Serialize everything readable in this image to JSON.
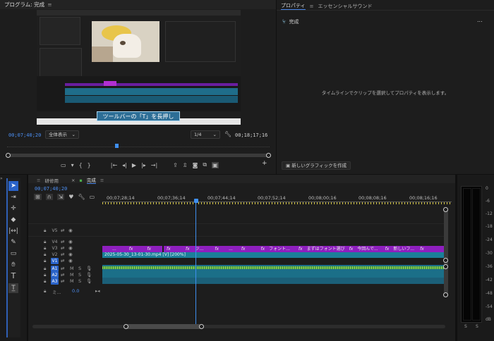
{
  "program": {
    "title": "プログラム: 完成",
    "timecode": "00;07;40;20",
    "zoom": "全体表示",
    "resolution": "1/4",
    "duration": "00;18;17;16",
    "caption": "ツールバーの「T」を長押し"
  },
  "properties": {
    "tab_properties": "プロパティ",
    "tab_essential": "エッセンシャルサウンド",
    "sequence": "完成",
    "message": "タイムラインでクリップを選択してプロパティを表示します。",
    "new_graphic": "新しいグラフィックを作成",
    "more": "..."
  },
  "timeline": {
    "tab1": "研修用",
    "tab2": "完成",
    "timecode": "00;07;40;20",
    "ruler": [
      "00;07;28;14",
      "00;07;36;14",
      "00;07;44;14",
      "00;07;52;14",
      "00;08;00;16",
      "00;08;08;16",
      "00;08;16;16"
    ],
    "tracks": [
      {
        "name": "V5",
        "active": false
      },
      {
        "name": "V4",
        "active": false
      },
      {
        "name": "V3",
        "active": false
      },
      {
        "name": "V2",
        "active": false
      },
      {
        "name": "V1",
        "active": true
      },
      {
        "name": "A1",
        "active": true
      },
      {
        "name": "A2",
        "active": true
      },
      {
        "name": "A3",
        "active": true
      }
    ],
    "mix_label": "ミ...",
    "mix_value": "0.0",
    "v1_clip": "2025-05-30_13-01-30.mp4 [V] [200%]",
    "v2_clips": [
      "...",
      "fx",
      "fx",
      "fx",
      "fx",
      "ツ...",
      "fx",
      "...",
      "fx",
      "fx",
      "フォント...",
      "fx",
      "まずはフォント選び",
      "fx",
      "今回んで...",
      "fx",
      "新しいフ...",
      "fx"
    ]
  },
  "meter": {
    "labels": [
      "0",
      "-6",
      "-12",
      "-18",
      "-24",
      "-30",
      "-36",
      "-42",
      "-48",
      "-54",
      "dB"
    ],
    "solo": [
      "S",
      "S"
    ]
  }
}
